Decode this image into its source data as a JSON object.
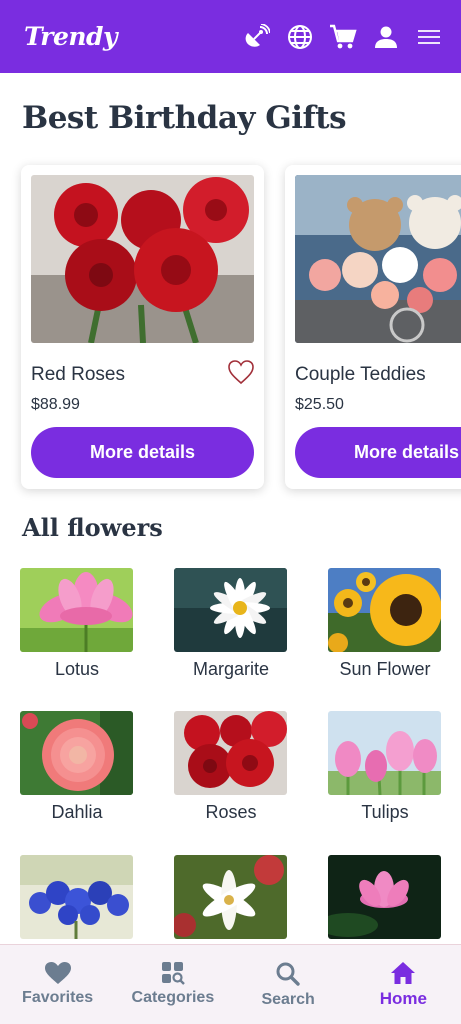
{
  "header": {
    "logo": "Trendy",
    "icons": [
      "satellite-dish-icon",
      "globe-icon",
      "cart-icon",
      "user-icon",
      "menu-icon"
    ],
    "bg_color": "#7a2de0"
  },
  "gifts": {
    "title": "Best Birthday Gifts",
    "items": [
      {
        "name": "Red Roses",
        "price": "$88.99",
        "button": "More details",
        "image": "red-roses-photo"
      },
      {
        "name": "Couple Teddies",
        "price": "$25.50",
        "button": "More details",
        "image": "teddy-bears-flowers-photo"
      }
    ]
  },
  "flowers": {
    "title": "All flowers",
    "items": [
      {
        "name": "Lotus"
      },
      {
        "name": "Margarite"
      },
      {
        "name": "Sun Flower"
      },
      {
        "name": "Dahlia"
      },
      {
        "name": "Roses"
      },
      {
        "name": "Tulips"
      },
      {
        "name": ""
      },
      {
        "name": ""
      },
      {
        "name": ""
      }
    ]
  },
  "bottom_nav": {
    "items": [
      {
        "label": "Favorites",
        "icon": "heart-icon"
      },
      {
        "label": "Categories",
        "icon": "categories-icon"
      },
      {
        "label": "Search",
        "icon": "search-icon"
      },
      {
        "label": "Home",
        "icon": "home-icon",
        "active": true
      }
    ]
  },
  "colors": {
    "accent": "#7a2de0",
    "text": "#2a3443",
    "nav_inactive": "#6c7d90"
  }
}
